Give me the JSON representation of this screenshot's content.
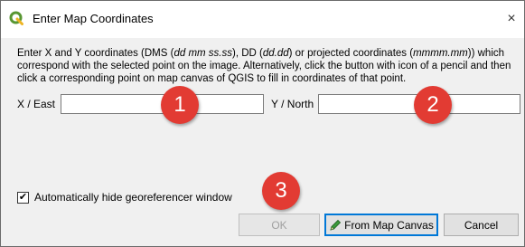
{
  "window": {
    "title": "Enter Map Coordinates",
    "app_icon": "qgis-logo-icon",
    "close_glyph": "×"
  },
  "instructions": {
    "part1": "Enter X and Y coordinates (DMS (",
    "dms_format": "dd mm ss.ss",
    "part2": "), DD (",
    "dd_format": "dd.dd",
    "part3": ") or projected coordinates (",
    "proj_format": "mmmm.mm",
    "part4": ")) which correspond with the selected point on the image. Alternatively, click the button with icon of a pencil and then click a corresponding point on map canvas of QGIS to fill in coordinates of that point."
  },
  "fields": {
    "x_label": "X / East",
    "x_value": "",
    "y_label": "Y / North",
    "y_value": ""
  },
  "badges": [
    "1",
    "2",
    "3"
  ],
  "checkbox": {
    "label": "Automatically hide georeferencer window",
    "checked": true,
    "check_glyph": "✔"
  },
  "buttons": {
    "ok_label": "OK",
    "ok_enabled": false,
    "from_canvas_label": "From Map Canvas",
    "from_canvas_icon": "pencil-icon",
    "cancel_label": "Cancel"
  },
  "colors": {
    "badge": "#e23b33",
    "qgis_green": "#589632",
    "qgis_yellow": "#eeb422",
    "focus": "#0078d7"
  }
}
